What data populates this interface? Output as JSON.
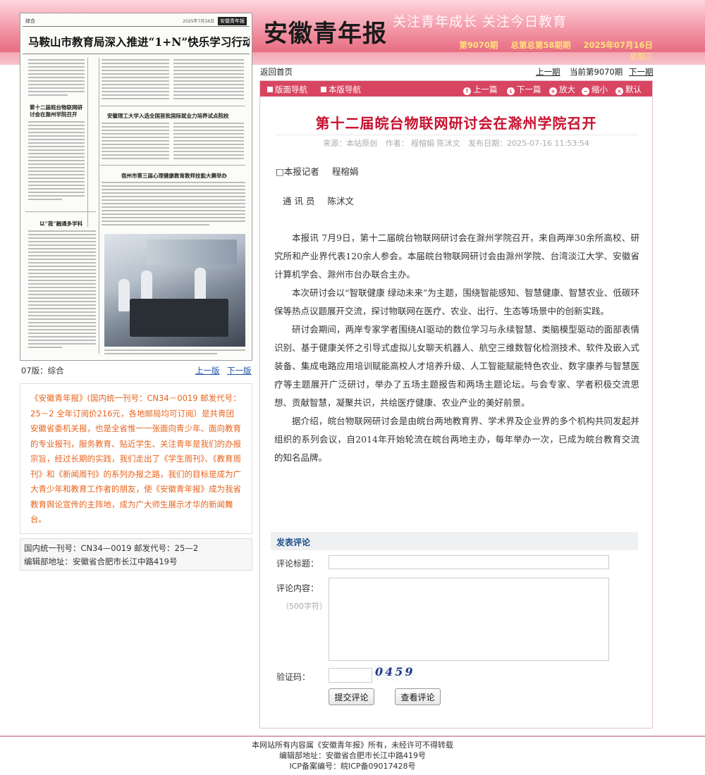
{
  "header": {
    "logo": "安徽青年报",
    "slogan": "关注青年成长   关注今日教育",
    "issue_no": "第9070期",
    "total_issue": "总第总第58期期",
    "date": "2025年07月16日",
    "weekday": "星期三"
  },
  "thumbnail": {
    "section_tag": "综合",
    "paper_name": "安徽青年报",
    "paper_date": "2025年7月16日",
    "headline": "马鞍山市教育局深入推进“1+N”快乐学习行动",
    "subhead_1": "第十二届皖台物联网研讨会在滁州学院召开",
    "subhead_2": "安徽理工大学入选全国首批国际就业力培养试点院校",
    "subhead_3": "宿州市第三届心理健康教育教师技能大赛举办",
    "subhead_4": "以“我”融通多学科"
  },
  "topnav": {
    "home": "返回首页",
    "prev_issue": "上一期",
    "current_issue": "当前第9070期",
    "next_issue": "下一期"
  },
  "toolbar": {
    "section_nav": "版面导航",
    "page_nav": "本版导航",
    "prev_article": "上一篇",
    "next_article": "下一篇",
    "zoom_in": "放大",
    "zoom_out": "缩小",
    "default": "默认"
  },
  "article": {
    "title": "第十二届皖台物联网研讨会在滁州学院召开",
    "source": "来源：本站原创",
    "author": "作者：  程榕娟    陈沭文",
    "pub_date": "发布日期：2025-07-16 11:53:54",
    "byline_1_label": "□本报记者",
    "byline_1_name": "程榕娟",
    "byline_2_label": "通 讯 员",
    "byline_2_name": "陈沭文",
    "paragraphs": [
      "本报讯    7月9日，第十二届皖台物联网研讨会在滁州学院召开，来自两岸30余所高校、研究所和产业界代表120余人参会。本届皖台物联网研讨会由滁州学院、台湾淡江大学、安徽省计算机学会、滁州市台办联合主办。",
      "本次研讨会以“智联健康  绿动未来”为主题，围绕智能感知、智慧健康、智慧农业、低碳环保等热点议题展开交流，探讨物联网在医疗、农业、出行、生态等场景中的创新实践。",
      "研讨会期间，两岸专家学者围绕AI驱动的数位学习与永续智慧、类脑模型驱动的面部表情识别、基于健康关怀之引导式虚拟儿女聊天机器人、航空三维数智化检测技术、软件及嵌入式装备、集成电路应用培训赋能高校人才培养升级、人工智能赋能特色农业、数字康养与智慧医疗等主题展开广泛研讨，举办了五场主题报告和两场主题论坛。与会专家、学者积极交流思想、贡献智慧，凝聚共识，共绘医疗健康、农业产业的美好前景。",
      "据介绍，皖台物联网研讨会是由皖台两地教育界、学术界及企业界的多个机构共同发起并组织的系列会议，自2014年开始轮流在皖台两地主办，每年举办一次，已成为皖台教育交流的知名品牌。"
    ]
  },
  "comment": {
    "heading": "发表评论",
    "title_label": "评论标题：",
    "content_label": "评论内容：",
    "content_hint": "（500字符）",
    "captcha_label": "验证码：",
    "captcha_text": "0459",
    "submit": "提交评论",
    "view": "查看评论"
  },
  "left": {
    "page_label": "07版：综合",
    "prev_page": "上一版",
    "next_page": "下一版",
    "intro": "《安徽青年报》(国内统一刊号：CN34－0019 邮发代号：25－2 全年订阅价216元，各地邮局均可订阅）是共青团安徽省委机关报，也是全省惟一一张面向青少年、面向教育的专业报刊，服务教育、贴近学生、关注青年是我们的办报宗旨，经过长期的实践，我们走出了《学生周刊》、《教育周刊》和《新闻周刊》的系列办报之路，我们的目标是成为广大青少年和教育工作者的朋友，使《安徽青年报》成为我省教育舆论宣传的主阵地，成为广大师生展示才华的新闻舞台。",
    "info_line_1": "国内统一刊号：CN34—0019 邮发代号：25—2",
    "info_line_2": "编辑部地址：安徽省合肥市长江中路419号"
  },
  "footer": {
    "line_1": "本网站所有内容属《安徽青年报》所有，未经许可不得转载",
    "line_2": "编辑部地址：安徽省合肥市长江中路419号",
    "line_3": "ICP备案编号：皖ICP备09017428号"
  }
}
